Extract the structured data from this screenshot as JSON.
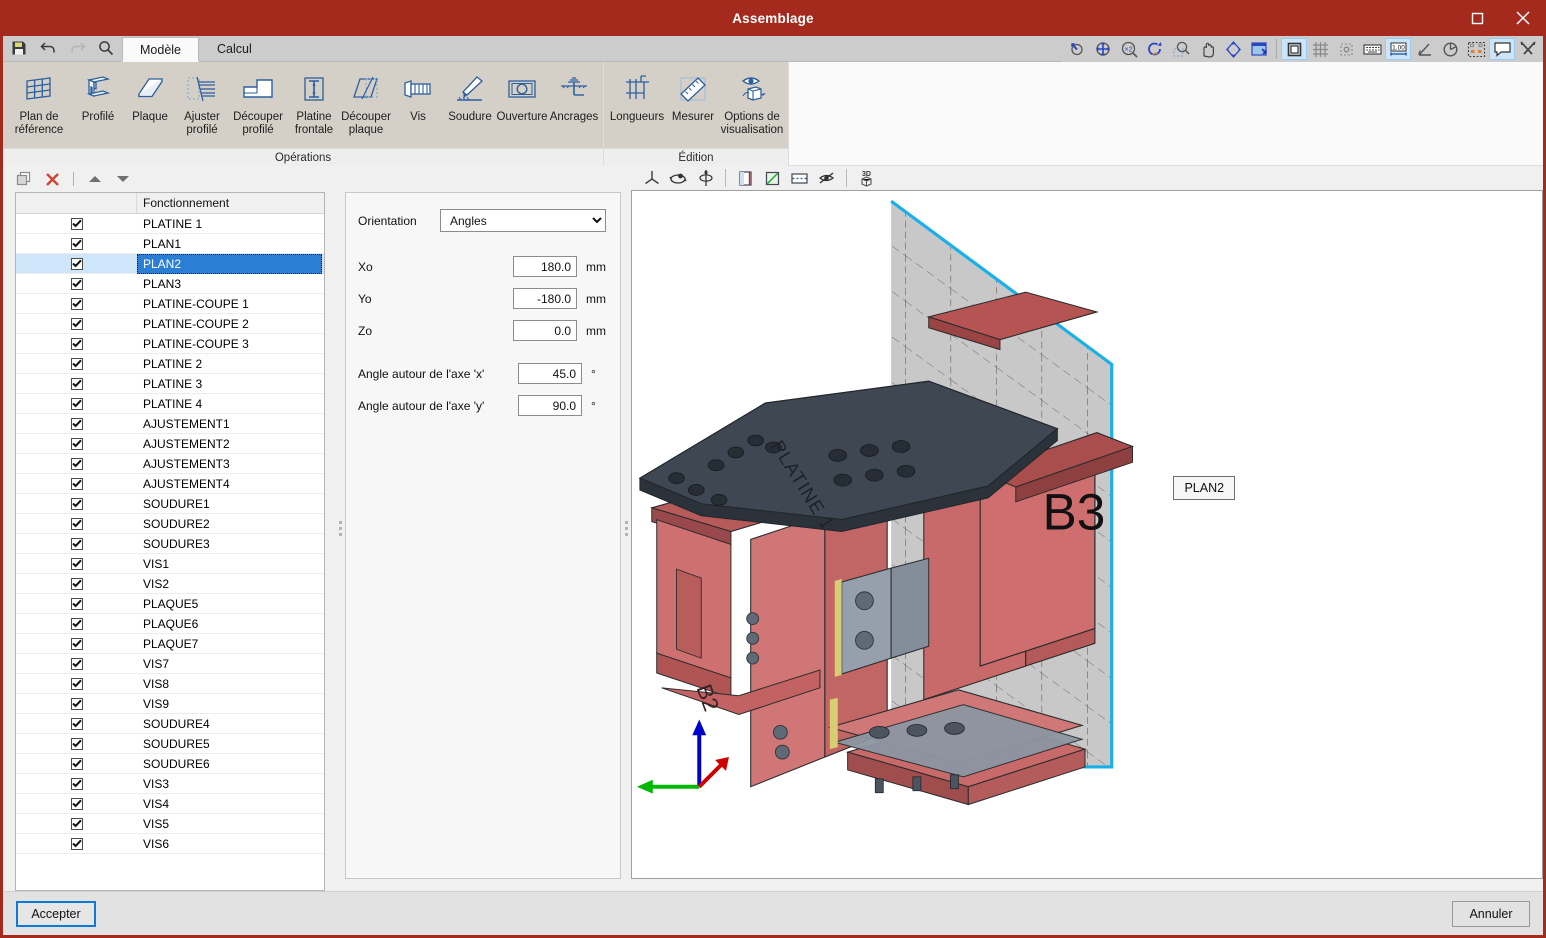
{
  "window": {
    "title": "Assemblage",
    "titlebar_color": "#a52a1e",
    "controls": [
      {
        "name": "maximize",
        "glyph": "maximize-icon"
      },
      {
        "name": "close",
        "glyph": "close-icon"
      }
    ]
  },
  "quick_access": [
    {
      "name": "save-icon",
      "label": "Enregistrer"
    },
    {
      "name": "undo-icon",
      "label": "Annuler l'action"
    },
    {
      "name": "redo-icon",
      "label": "Rétablir"
    },
    {
      "name": "search-icon",
      "label": "Rechercher"
    }
  ],
  "tabs": [
    {
      "label": "Modèle",
      "active": true
    },
    {
      "label": "Calcul",
      "active": false
    }
  ],
  "ribbon": {
    "groups": [
      {
        "title": "Opérations",
        "buttons": [
          {
            "label": "Plan de référence",
            "icon": "grid-plane-icon",
            "width": "wide"
          },
          {
            "label": "Profilé",
            "icon": "i-beam-icon",
            "width": ""
          },
          {
            "label": "Plaque",
            "icon": "plate-icon",
            "width": ""
          },
          {
            "label": "Ajuster profilé",
            "icon": "fit-profile-icon",
            "width": ""
          },
          {
            "label": "Découper profilé",
            "icon": "cut-profile-icon",
            "width": "w2"
          },
          {
            "label": "Platine frontale",
            "icon": "end-plate-icon",
            "width": ""
          },
          {
            "label": "Découper plaque",
            "icon": "cut-plate-icon",
            "width": ""
          },
          {
            "label": "Vis",
            "icon": "bolt-icon",
            "width": ""
          },
          {
            "label": "Soudure",
            "icon": "weld-icon",
            "width": ""
          },
          {
            "label": "Ouverture",
            "icon": "opening-icon",
            "width": ""
          },
          {
            "label": "Ancrages",
            "icon": "anchor-icon",
            "width": ""
          }
        ]
      },
      {
        "title": "Édition",
        "buttons": [
          {
            "label": "Longueurs",
            "icon": "lengths-icon",
            "width": "w2"
          },
          {
            "label": "Mesurer",
            "icon": "ruler-icon",
            "width": ""
          },
          {
            "label": "Options de visualisation",
            "icon": "eye-cube-icon",
            "width": "wide"
          }
        ]
      }
    ]
  },
  "view_toolbar_top": {
    "nav_icons": [
      {
        "name": "rotate-view-icon",
        "selected": false
      },
      {
        "name": "zoom-all-icon",
        "selected": false
      },
      {
        "name": "zoom-2x-icon",
        "selected": false
      },
      {
        "name": "refresh-view-icon",
        "selected": false
      },
      {
        "name": "zoom-window-icon",
        "selected": false
      },
      {
        "name": "pan-icon",
        "selected": false
      },
      {
        "name": "orbit-icon",
        "selected": false
      },
      {
        "name": "restore-view-icon",
        "selected": false
      }
    ],
    "display_icons": [
      {
        "name": "solid-view-icon",
        "selected": true
      },
      {
        "name": "grid-icon",
        "selected": false
      },
      {
        "name": "node-icon",
        "selected": false
      },
      {
        "name": "keyboard-icon",
        "selected": false
      },
      {
        "name": "dimension-icon",
        "selected": true
      },
      {
        "name": "angle-icon",
        "selected": false
      },
      {
        "name": "pie-icon",
        "selected": false
      },
      {
        "name": "selection-box-icon",
        "selected": false
      },
      {
        "name": "comment-icon",
        "selected": true
      },
      {
        "name": "tools-icon",
        "selected": false
      }
    ]
  },
  "tree_toolbar": [
    {
      "name": "duplicate-icon"
    },
    {
      "name": "delete-icon"
    },
    {
      "name": "move-up-icon"
    },
    {
      "name": "move-down-icon"
    }
  ],
  "tree": {
    "column_header": "Fonctionnement",
    "rows": [
      {
        "label": "PLATINE 1",
        "checked": true,
        "selected": false
      },
      {
        "label": "PLAN1",
        "checked": true,
        "selected": false
      },
      {
        "label": "PLAN2",
        "checked": true,
        "selected": true
      },
      {
        "label": "PLAN3",
        "checked": true,
        "selected": false
      },
      {
        "label": "PLATINE-COUPE 1",
        "checked": true,
        "selected": false
      },
      {
        "label": "PLATINE-COUPE 2",
        "checked": true,
        "selected": false
      },
      {
        "label": "PLATINE-COUPE 3",
        "checked": true,
        "selected": false
      },
      {
        "label": "PLATINE 2",
        "checked": true,
        "selected": false
      },
      {
        "label": "PLATINE 3",
        "checked": true,
        "selected": false
      },
      {
        "label": "PLATINE 4",
        "checked": true,
        "selected": false
      },
      {
        "label": "AJUSTEMENT1",
        "checked": true,
        "selected": false
      },
      {
        "label": "AJUSTEMENT2",
        "checked": true,
        "selected": false
      },
      {
        "label": "AJUSTEMENT3",
        "checked": true,
        "selected": false
      },
      {
        "label": "AJUSTEMENT4",
        "checked": true,
        "selected": false
      },
      {
        "label": "SOUDURE1",
        "checked": true,
        "selected": false
      },
      {
        "label": "SOUDURE2",
        "checked": true,
        "selected": false
      },
      {
        "label": "SOUDURE3",
        "checked": true,
        "selected": false
      },
      {
        "label": "VIS1",
        "checked": true,
        "selected": false
      },
      {
        "label": "VIS2",
        "checked": true,
        "selected": false
      },
      {
        "label": "PLAQUE5",
        "checked": true,
        "selected": false
      },
      {
        "label": "PLAQUE6",
        "checked": true,
        "selected": false
      },
      {
        "label": "PLAQUE7",
        "checked": true,
        "selected": false
      },
      {
        "label": "VIS7",
        "checked": true,
        "selected": false
      },
      {
        "label": "VIS8",
        "checked": true,
        "selected": false
      },
      {
        "label": "VIS9",
        "checked": true,
        "selected": false
      },
      {
        "label": "SOUDURE4",
        "checked": true,
        "selected": false
      },
      {
        "label": "SOUDURE5",
        "checked": true,
        "selected": false
      },
      {
        "label": "SOUDURE6",
        "checked": true,
        "selected": false
      },
      {
        "label": "VIS3",
        "checked": true,
        "selected": false
      },
      {
        "label": "VIS4",
        "checked": true,
        "selected": false
      },
      {
        "label": "VIS5",
        "checked": true,
        "selected": false
      },
      {
        "label": "VIS6",
        "checked": true,
        "selected": false
      }
    ]
  },
  "properties": {
    "orientation_label": "Orientation",
    "orientation_value": "Angles",
    "orientation_options": [
      "Angles"
    ],
    "fields": [
      {
        "label": "Xo",
        "value": "180.0",
        "unit": "mm"
      },
      {
        "label": "Yo",
        "value": "-180.0",
        "unit": "mm"
      },
      {
        "label": "Zo",
        "value": "0.0",
        "unit": "mm"
      }
    ],
    "angles": [
      {
        "label": "Angle autour de l'axe 'x'",
        "value": "45.0",
        "unit": "°"
      },
      {
        "label": "Angle autour de l'axe 'y'",
        "value": "90.0",
        "unit": "°"
      }
    ]
  },
  "view_toolbar_left": [
    {
      "name": "axes-icon"
    },
    {
      "name": "rotate-model-icon"
    },
    {
      "name": "mirror-icon"
    },
    {
      "name": "section-icon"
    },
    {
      "name": "shade-icon"
    },
    {
      "name": "clip-icon"
    },
    {
      "name": "hide-icon"
    },
    {
      "name": "3d-icon"
    }
  ],
  "viewport": {
    "plan_label": "PLAN2",
    "model_labels": [
      {
        "text": "B3"
      },
      {
        "text": "PLATINE 1"
      },
      {
        "text": "B2"
      }
    ],
    "colors": {
      "plane_outline": "#17b0ea",
      "plane_fill": "#c8c8c8",
      "beam_red": "#cd6c6c",
      "beam_dark_red": "#8e4040",
      "plate_grey": "#4a525c",
      "bolt_grey": "#9aa3ad",
      "axis_z": "#0000cc",
      "axis_y": "#00b800",
      "axis_x": "#d00000"
    }
  },
  "footer": {
    "accept_label": "Accepter",
    "cancel_label": "Annuler"
  }
}
